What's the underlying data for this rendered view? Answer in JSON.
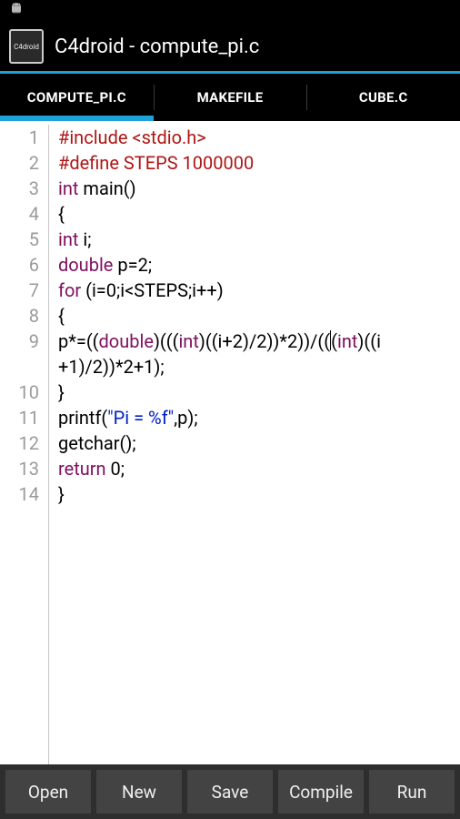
{
  "status": {},
  "header": {
    "app_icon_text": "C4droid",
    "title": "C4droid - compute_pi.c"
  },
  "tabs": [
    {
      "label": "COMPUTE_PI.C",
      "active": true
    },
    {
      "label": "MAKEFILE",
      "active": false
    },
    {
      "label": "CUBE.C",
      "active": false
    }
  ],
  "code": {
    "line_numbers": [
      "1",
      "2",
      "3",
      "4",
      "5",
      "6",
      "7",
      "8",
      "9",
      "",
      "10",
      "11",
      "12",
      "13",
      "14"
    ],
    "lines": [
      [
        {
          "t": "#include <stdio.h>",
          "c": "pp"
        }
      ],
      [
        {
          "t": "#define STEPS 1000000",
          "c": "pp"
        }
      ],
      [
        {
          "t": "int",
          "c": "k"
        },
        {
          "t": " main()",
          "c": ""
        }
      ],
      [
        {
          "t": "{",
          "c": ""
        }
      ],
      [
        {
          "t": "int",
          "c": "k"
        },
        {
          "t": " i;",
          "c": ""
        }
      ],
      [
        {
          "t": "double",
          "c": "k"
        },
        {
          "t": " p=2;",
          "c": ""
        }
      ],
      [
        {
          "t": "for",
          "c": "k"
        },
        {
          "t": " (i=0;i<STEPS;i++)",
          "c": ""
        }
      ],
      [
        {
          "t": "{",
          "c": ""
        }
      ],
      [
        {
          "t": "p*=((",
          "c": ""
        },
        {
          "t": "double",
          "c": "k"
        },
        {
          "t": ")(((",
          "c": ""
        },
        {
          "t": "int",
          "c": "k"
        },
        {
          "t": ")((i+2)/2))*2))/((",
          "c": ""
        },
        {
          "t": "",
          "c": "",
          "cursor": true
        },
        {
          "t": "(",
          "c": ""
        },
        {
          "t": "int",
          "c": "k"
        },
        {
          "t": ")((i",
          "c": ""
        }
      ],
      [
        {
          "t": "+1)/2))*2+1);",
          "c": "",
          "wrap": true
        }
      ],
      [
        {
          "t": "}",
          "c": ""
        }
      ],
      [
        {
          "t": "printf(",
          "c": ""
        },
        {
          "t": "\"Pi = %f\"",
          "c": "s"
        },
        {
          "t": ",p);",
          "c": ""
        }
      ],
      [
        {
          "t": "getchar();",
          "c": ""
        }
      ],
      [
        {
          "t": "return",
          "c": "k"
        },
        {
          "t": " 0;",
          "c": ""
        }
      ],
      [
        {
          "t": "}",
          "c": ""
        }
      ]
    ]
  },
  "bottom_buttons": [
    "Open",
    "New",
    "Save",
    "Compile",
    "Run"
  ]
}
